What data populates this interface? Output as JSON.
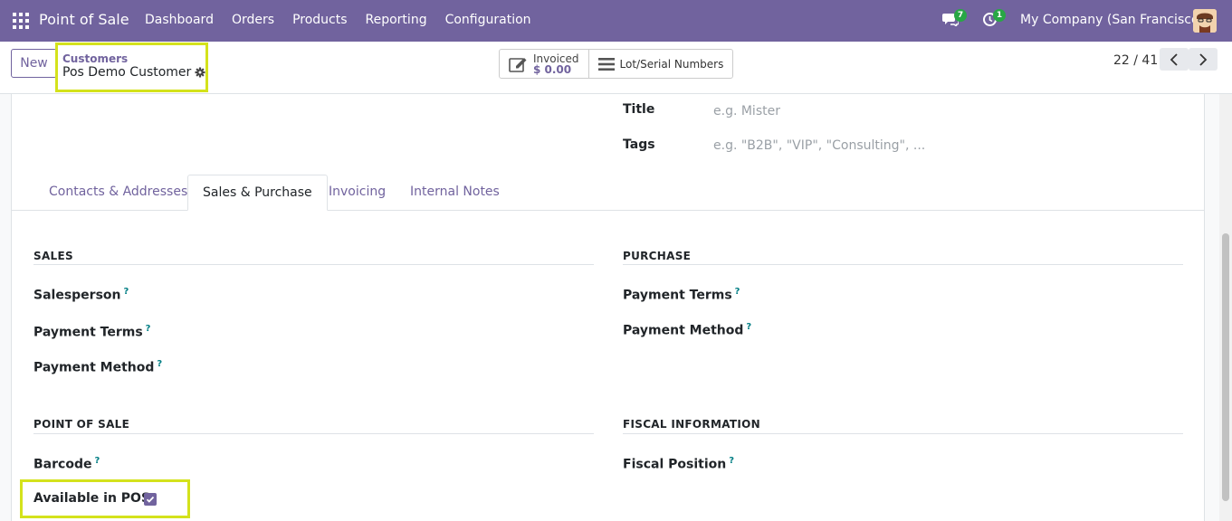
{
  "nav": {
    "app_title": "Point of Sale",
    "menu": [
      "Dashboard",
      "Orders",
      "Products",
      "Reporting",
      "Configuration"
    ],
    "chat_count": "7",
    "activity_count": "1",
    "company": "My Company (San Francisco)"
  },
  "control": {
    "new_label": "New",
    "breadcrumb_parent": "Customers",
    "breadcrumb_current": "Pos Demo Customer",
    "invoiced_label": "Invoiced",
    "invoiced_value": "$ 0.00",
    "lot_label": "Lot/Serial Numbers",
    "pager": "22 / 41"
  },
  "form": {
    "title_label": "Title",
    "title_placeholder": "e.g. Mister",
    "tags_label": "Tags",
    "tags_placeholder": "e.g. \"B2B\", \"VIP\", \"Consulting\", ...",
    "tabs": [
      "Contacts & Addresses",
      "Sales & Purchase",
      "Invoicing",
      "Internal Notes"
    ],
    "active_tab": "Sales & Purchase",
    "sales": {
      "heading": "SALES",
      "salesperson": "Salesperson",
      "payment_terms": "Payment Terms",
      "payment_method": "Payment Method"
    },
    "purchase": {
      "heading": "PURCHASE",
      "payment_terms": "Payment Terms",
      "payment_method": "Payment Method"
    },
    "pos": {
      "heading": "POINT OF SALE",
      "barcode": "Barcode",
      "available_in_pos": "Available in POS",
      "available_checked": true
    },
    "fiscal": {
      "heading": "FISCAL INFORMATION",
      "fiscal_position": "Fiscal Position"
    },
    "help_mark": "?"
  },
  "colors": {
    "brand": "#71639e",
    "highlight": "#d4e21c",
    "badge": "#28a745"
  }
}
